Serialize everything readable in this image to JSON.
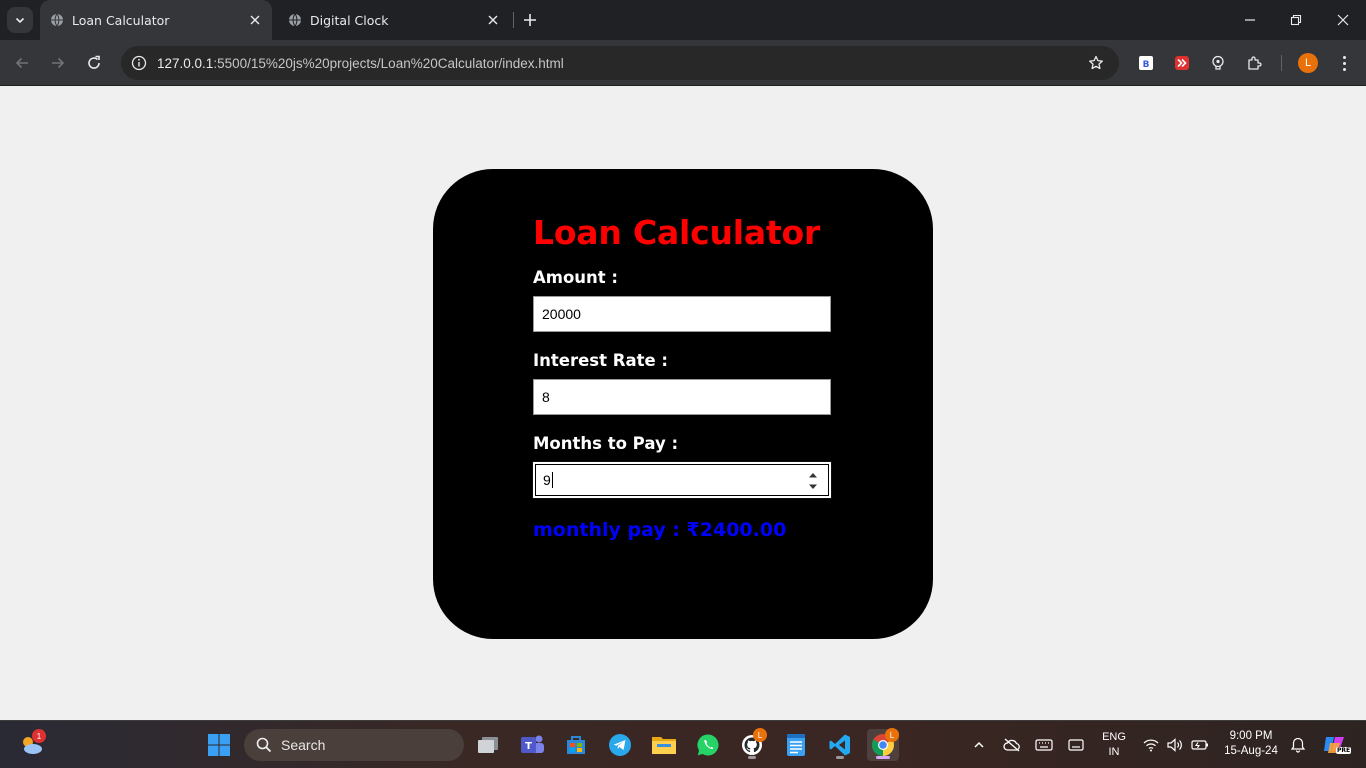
{
  "browser": {
    "tabs": [
      {
        "title": "Loan Calculator",
        "active": true
      },
      {
        "title": "Digital Clock",
        "active": false
      }
    ],
    "url": "127.0.0.1:5500/15%20js%20projects/Loan%20Calculator/index.html",
    "url_host": "127.0.0.1",
    "url_rest": ":5500/15%20js%20projects/Loan%20Calculator/index.html",
    "profile_initial": "L"
  },
  "page": {
    "title": "Loan Calculator",
    "amount_label": "Amount :",
    "amount_value": "20000",
    "interest_label": "Interest Rate :",
    "interest_value": "8",
    "months_label": "Months to Pay :",
    "months_value": "9",
    "result_text": "monthly pay : ₹2400.00",
    "colors": {
      "card": "#000000",
      "title": "#ff0000",
      "result": "#0000ff",
      "background": "#f0f0f0"
    }
  },
  "taskbar": {
    "search_placeholder": "Search",
    "weather_badge": "1",
    "github_badge": "L",
    "chrome_badge": "L",
    "language": "ENG",
    "region": "IN",
    "time": "9:00 PM",
    "date": "15-Aug-24",
    "copilot_label": "PRE"
  }
}
